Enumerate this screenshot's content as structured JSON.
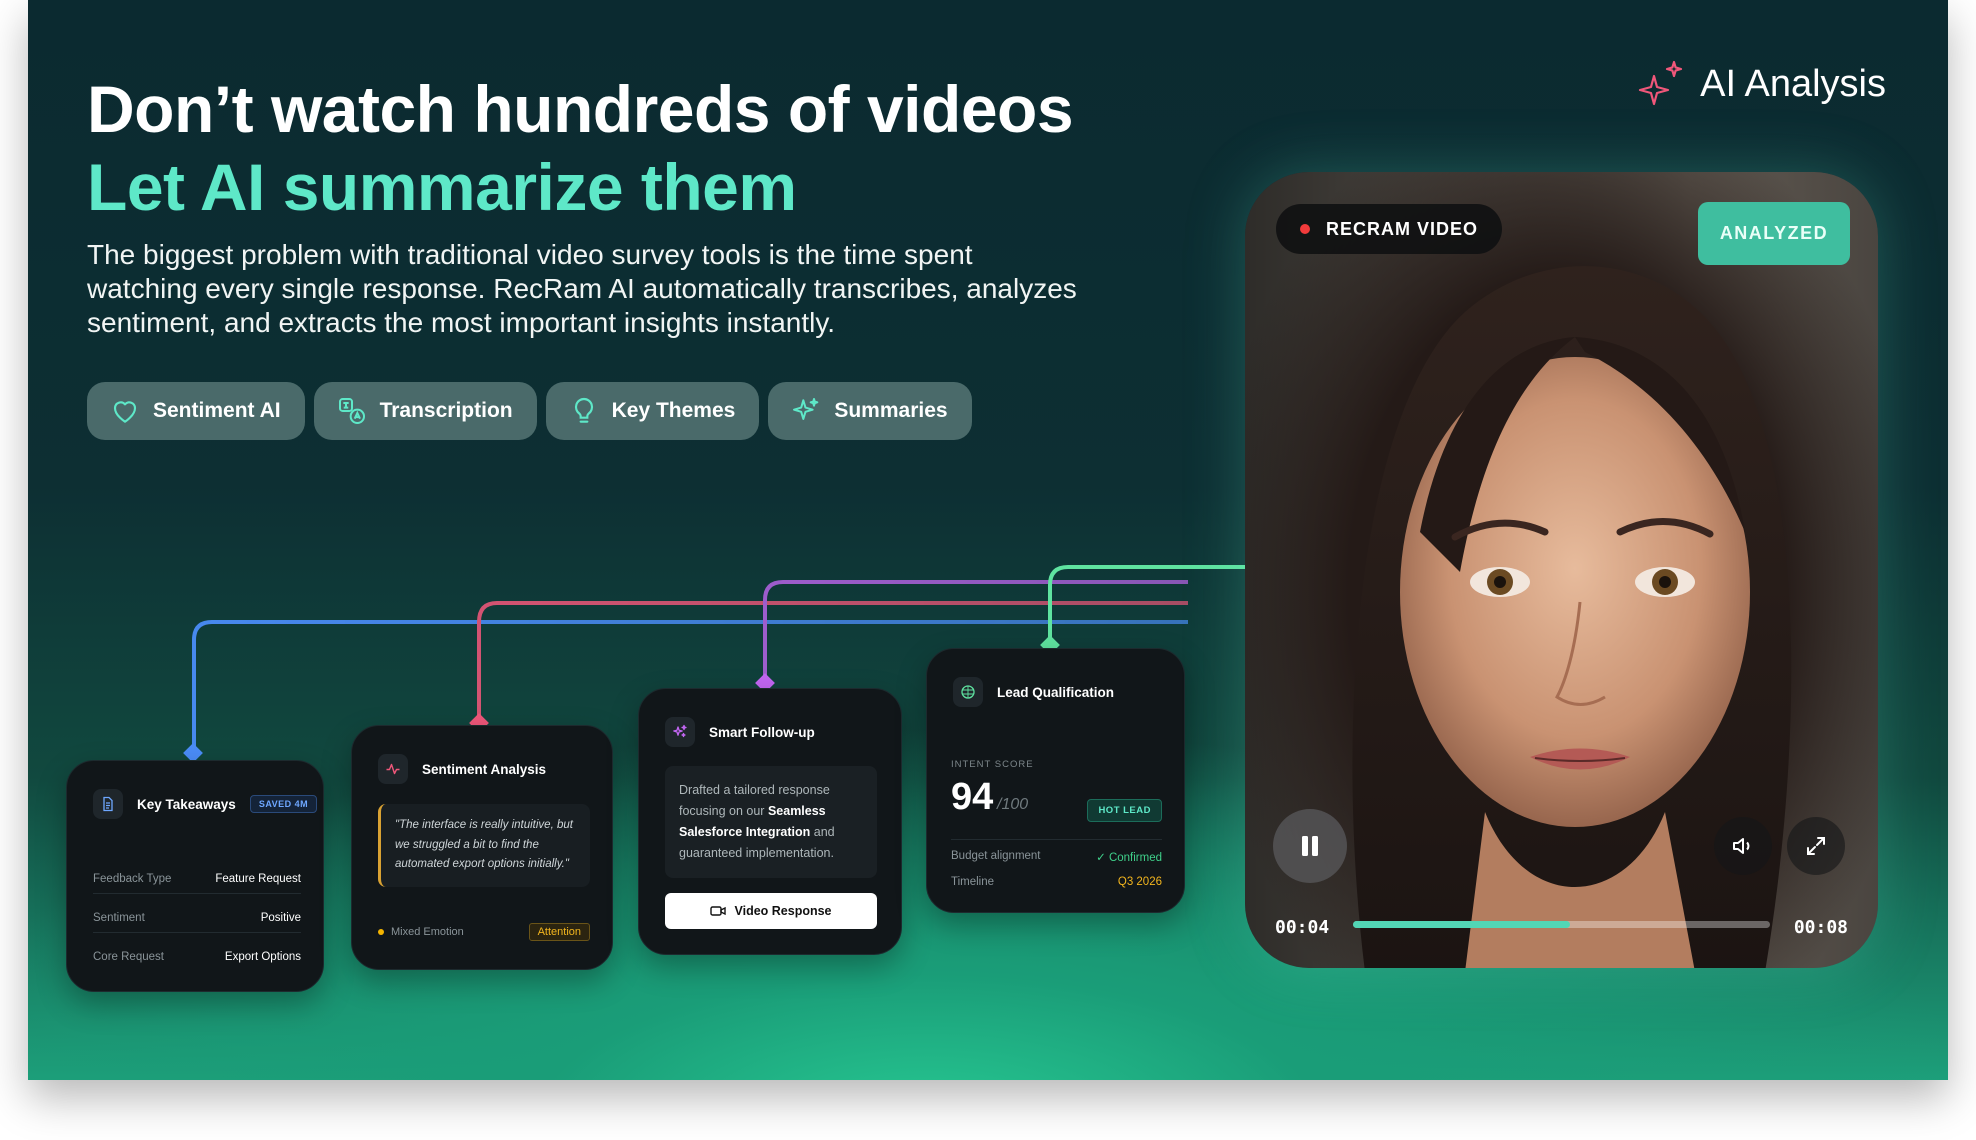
{
  "headline": {
    "line1": "Don’t watch hundreds of videos",
    "line2": "Let AI summarize them"
  },
  "description": "The biggest problem with traditional video survey tools is the time spent watching every single response. RecRam AI automatically transcribes, analyzes sentiment, and extracts the most important insights instantly.",
  "features": [
    {
      "label": "Sentiment AI",
      "icon": "heart-icon"
    },
    {
      "label": "Transcription",
      "icon": "translate-icon"
    },
    {
      "label": "Key Themes",
      "icon": "lightbulb-icon"
    },
    {
      "label": "Summaries",
      "icon": "sparkle-icon"
    }
  ],
  "brand": {
    "label": "AI Analysis",
    "icon": "sparkles-icon"
  },
  "colors": {
    "accent": "#5ee8c8",
    "blue": "#4b8df8",
    "pink": "#f0577a",
    "purple": "#c266f2",
    "green": "#5fe3a0"
  },
  "key_takeaways": {
    "title": "Key Takeaways",
    "badge": "SAVED 4M",
    "rows": [
      {
        "key": "Feedback Type",
        "value": "Feature Request"
      },
      {
        "key": "Sentiment",
        "value": "Positive"
      },
      {
        "key": "Core Request",
        "value": "Export Options"
      }
    ]
  },
  "sentiment": {
    "title": "Sentiment Analysis",
    "quote": "\"The interface is really intuitive, but we struggled a bit to find the automated export options initially.\"",
    "status": "Mixed Emotion",
    "badge": "Attention"
  },
  "followup": {
    "title": "Smart Follow-up",
    "text_before": "Drafted a tailored response focusing on our ",
    "text_bold": "Seamless Salesforce Integration",
    "text_after": " and guaranteed implementation.",
    "button": "Video Response"
  },
  "lead": {
    "title": "Lead Qualification",
    "intent_label": "INTENT SCORE",
    "score": "94",
    "score_max": "/100",
    "badge": "HOT LEAD",
    "rows": [
      {
        "key": "Budget alignment",
        "value": "✓ Confirmed",
        "color": "#3fd08a"
      },
      {
        "key": "Timeline",
        "value": "Q3 2026",
        "color": "#f2b51e"
      }
    ]
  },
  "player": {
    "source_label": "RECRAM VIDEO",
    "status_badge": "ANALYZED",
    "current_time": "00:04",
    "total_time": "00:08",
    "progress": 0.52
  }
}
